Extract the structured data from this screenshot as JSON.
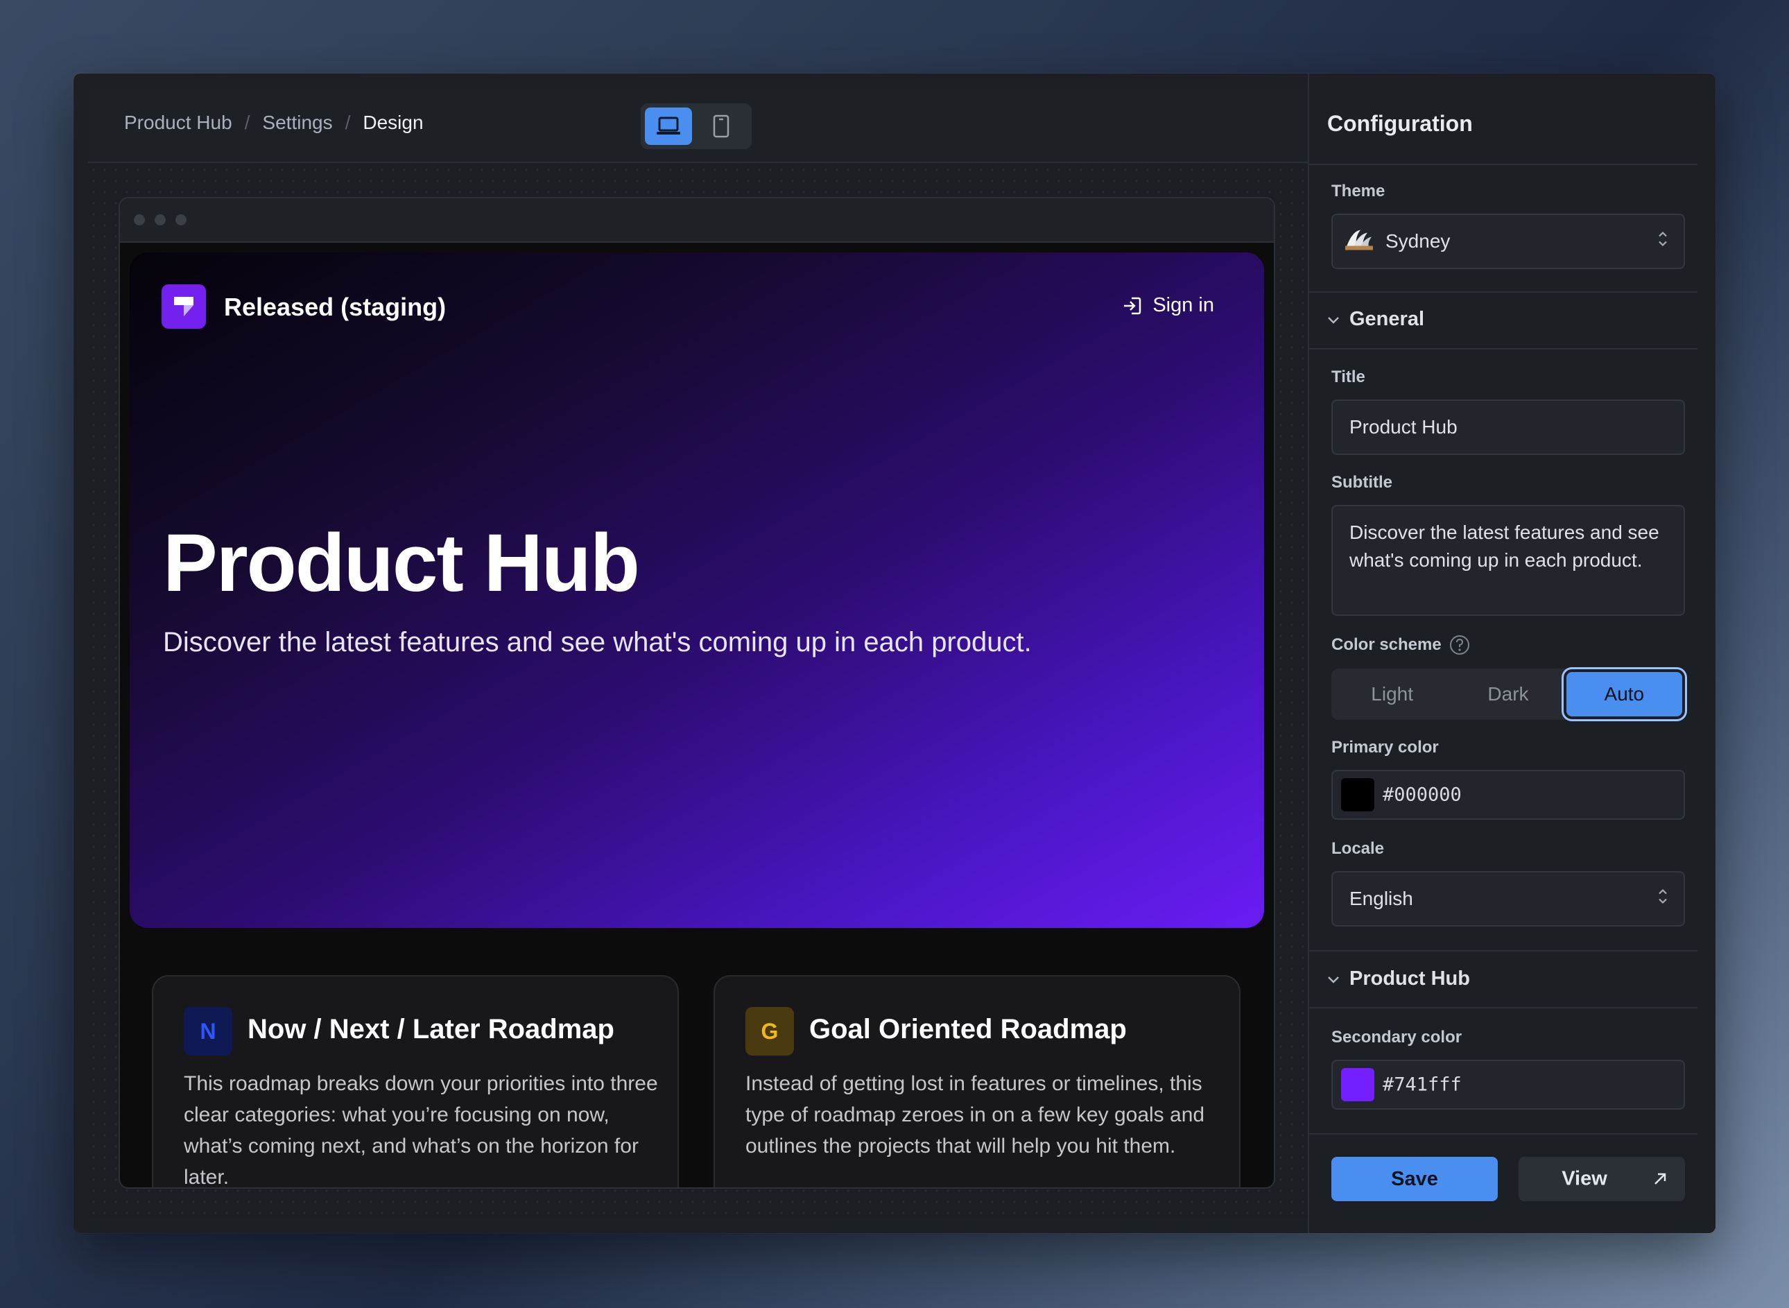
{
  "breadcrumb": {
    "items": [
      "Product Hub",
      "Settings",
      "Design"
    ]
  },
  "preview": {
    "brand": "Released (staging)",
    "sign_in": "Sign in",
    "hero_title": "Product Hub",
    "hero_subtitle": "Discover the latest features and see what's coming up in each product.",
    "cards": [
      {
        "badge": "N",
        "title": "Now / Next / Later Roadmap",
        "description": "This roadmap breaks down your priorities into three clear categories: what you’re focusing on now, what’s coming next, and what’s on the horizon for later.",
        "badge_bg": "#0f1a55",
        "badge_fg": "#2f55ff"
      },
      {
        "badge": "G",
        "title": "Goal Oriented Roadmap",
        "description": "Instead of getting lost in features or timelines, this type of roadmap zeroes in on a few key goals and outlines the projects that will help you hit them.",
        "badge_bg": "#4a3a10",
        "badge_fg": "#f1b81c"
      }
    ]
  },
  "config": {
    "title": "Configuration",
    "theme": {
      "label": "Theme",
      "value": "Sydney",
      "icon": "opera-house-icon"
    },
    "general": {
      "heading": "General",
      "title_label": "Title",
      "title_value": "Product Hub",
      "subtitle_label": "Subtitle",
      "subtitle_value": "Discover the latest features and see what's coming up in each product.",
      "color_scheme_label": "Color scheme",
      "color_scheme_options": [
        "Light",
        "Dark",
        "Auto"
      ],
      "color_scheme_selected": "Auto",
      "primary_color_label": "Primary color",
      "primary_color_value": "#000000",
      "locale_label": "Locale",
      "locale_value": "English"
    },
    "product_hub": {
      "heading": "Product Hub",
      "secondary_color_label": "Secondary color",
      "secondary_color_value": "#741fff"
    },
    "save_label": "Save",
    "view_label": "View"
  },
  "colors": {
    "accent": "#4a8ef0",
    "brand_purple": "#741fff"
  }
}
